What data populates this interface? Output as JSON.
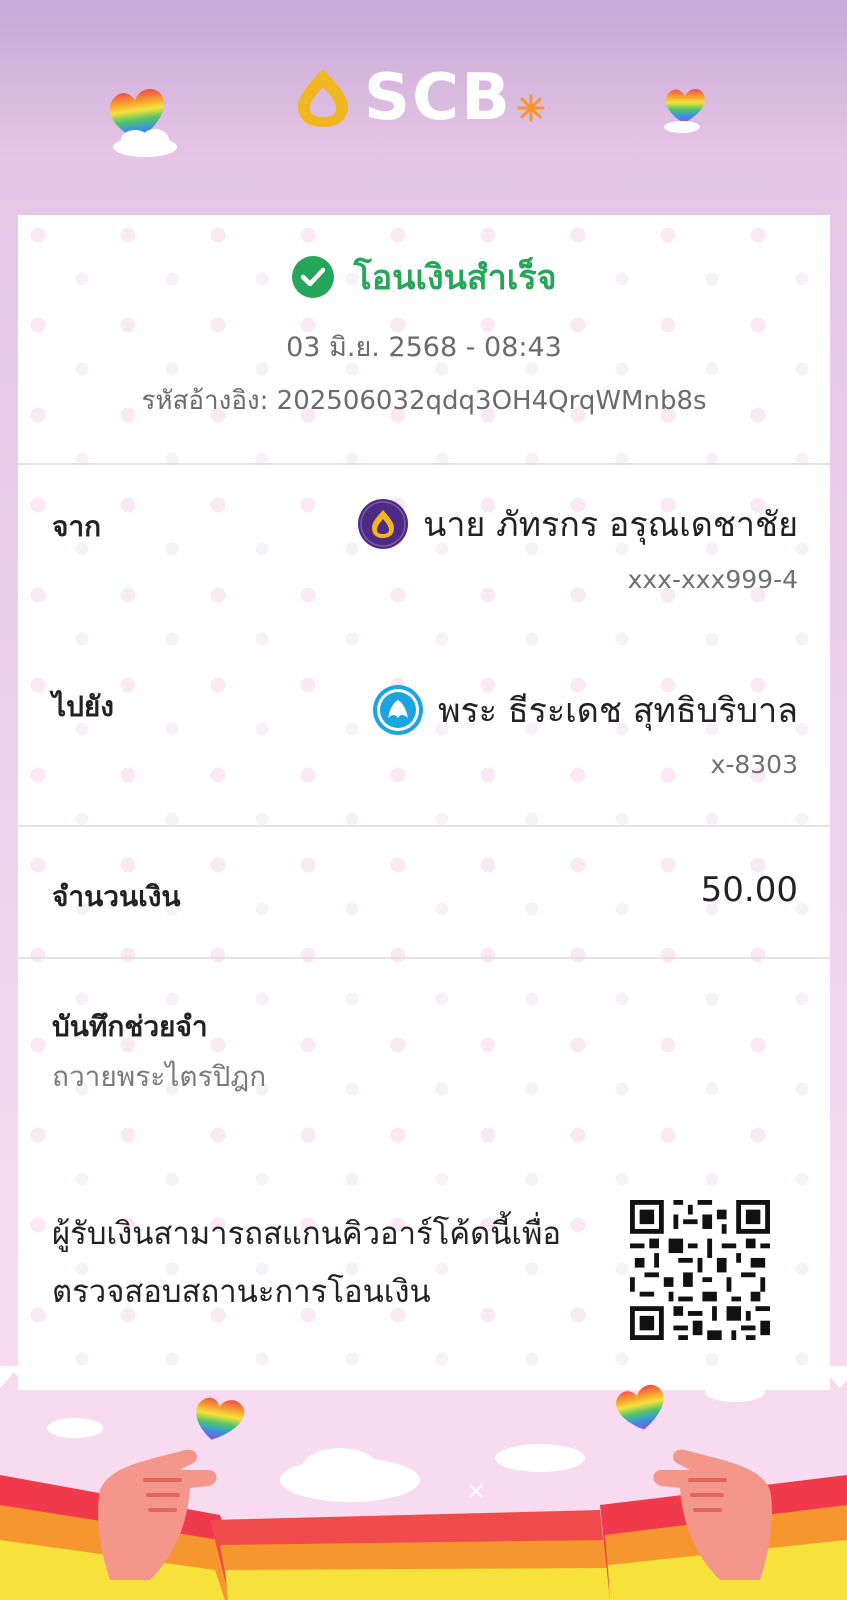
{
  "brand": {
    "name": "SCB"
  },
  "receipt": {
    "status": "โอนเงินสำเร็จ",
    "datetime": "03 มิ.ย. 2568 - 08:43",
    "reference": "รหัสอ้างอิง: 202506032qdq3OH4QrqWMnb8s",
    "from": {
      "label": "จาก",
      "name": "นาย ภัทรกร อรุณเดชาชัย",
      "account": "xxx-xxx999-4",
      "bank_icon": "scb-bank-icon"
    },
    "to": {
      "label": "ไปยัง",
      "name": "พระ ธีระเดช สุทธิบริบาล",
      "account": "x-8303",
      "bank_icon": "ktb-bank-icon"
    },
    "amount": {
      "label": "จำนวนเงิน",
      "value": "50.00"
    },
    "memo": {
      "label": "บันทึกช่วยจำ",
      "value": "ถวายพระไตรปิฎก"
    },
    "qr": {
      "text": "ผู้รับเงินสามารถสแกนคิวอาร์โค้ดนี้เพื่อตรวจสอบสถานะการโอนเงิน"
    }
  },
  "colors": {
    "success": "#26a65a",
    "scb_purple": "#4e2a84",
    "scb_gold": "#f0b81e",
    "ktb_blue": "#1ba5e0"
  }
}
